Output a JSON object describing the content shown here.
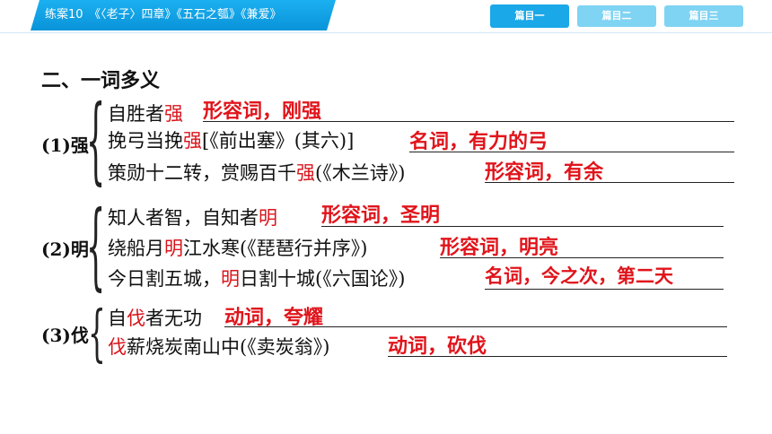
{
  "header": {
    "title": "练案10　《〈老子〉四章》《五石之瓠》《兼爱》",
    "nav": [
      "篇目一",
      "篇目二",
      "篇目三"
    ]
  },
  "section_heading": "二、一词多义",
  "groups": [
    {
      "label": "(1)强",
      "items": [
        {
          "pre": "自胜者",
          "key": "强",
          "post": "",
          "answer": "形容词，刚强"
        },
        {
          "pre": "挽弓当挽",
          "key": "强",
          "post": "[《前出塞》(其六)]",
          "answer": "名词，有力的弓"
        },
        {
          "pre": "策勋十二转，赏赐百千",
          "key": "强",
          "post": "(《木兰诗》)",
          "answer": "形容词，有余"
        }
      ]
    },
    {
      "label": "(2)明",
      "items": [
        {
          "pre": "知人者智，自知者",
          "key": "明",
          "post": "",
          "answer": "形容词，圣明"
        },
        {
          "pre": "绕船月",
          "key": "明",
          "post": "江水寒(《琵琶行并序》)",
          "answer": "形容词，明亮"
        },
        {
          "pre": "今日割五城，",
          "key": "明",
          "post": "日割十城(《六国论》)",
          "answer": "名词，今之次，第二天"
        }
      ]
    },
    {
      "label": "(3)伐",
      "items": [
        {
          "pre": "自",
          "key": "伐",
          "post": "者无功",
          "answer": "动词，夸耀"
        },
        {
          "pre": "",
          "key": "伐",
          "post": "薪烧炭南山中(《卖炭翁》)",
          "answer": "动词，砍伐"
        }
      ]
    }
  ],
  "colors": {
    "accent": "#0a93d9",
    "nav_active": "#1aa8e8",
    "nav_inactive": "#7fd3f3",
    "highlight": "#d8151c"
  }
}
